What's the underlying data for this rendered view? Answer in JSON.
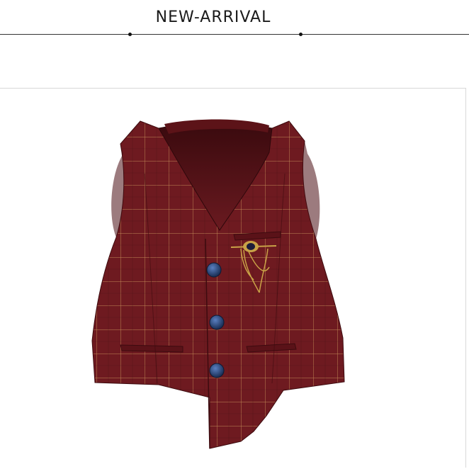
{
  "header": {
    "title": "NEW-ARRIVAL"
  },
  "product_image": {
    "subject": "burgundy-plaid-vest-icon",
    "colors": {
      "fabric": "#6e1a20",
      "fabric_dark": "#4a0f14",
      "lining": "#5a1016",
      "plaid": "#c8915a",
      "button": "#1f3a6b",
      "brooch": "#c9a247"
    }
  }
}
